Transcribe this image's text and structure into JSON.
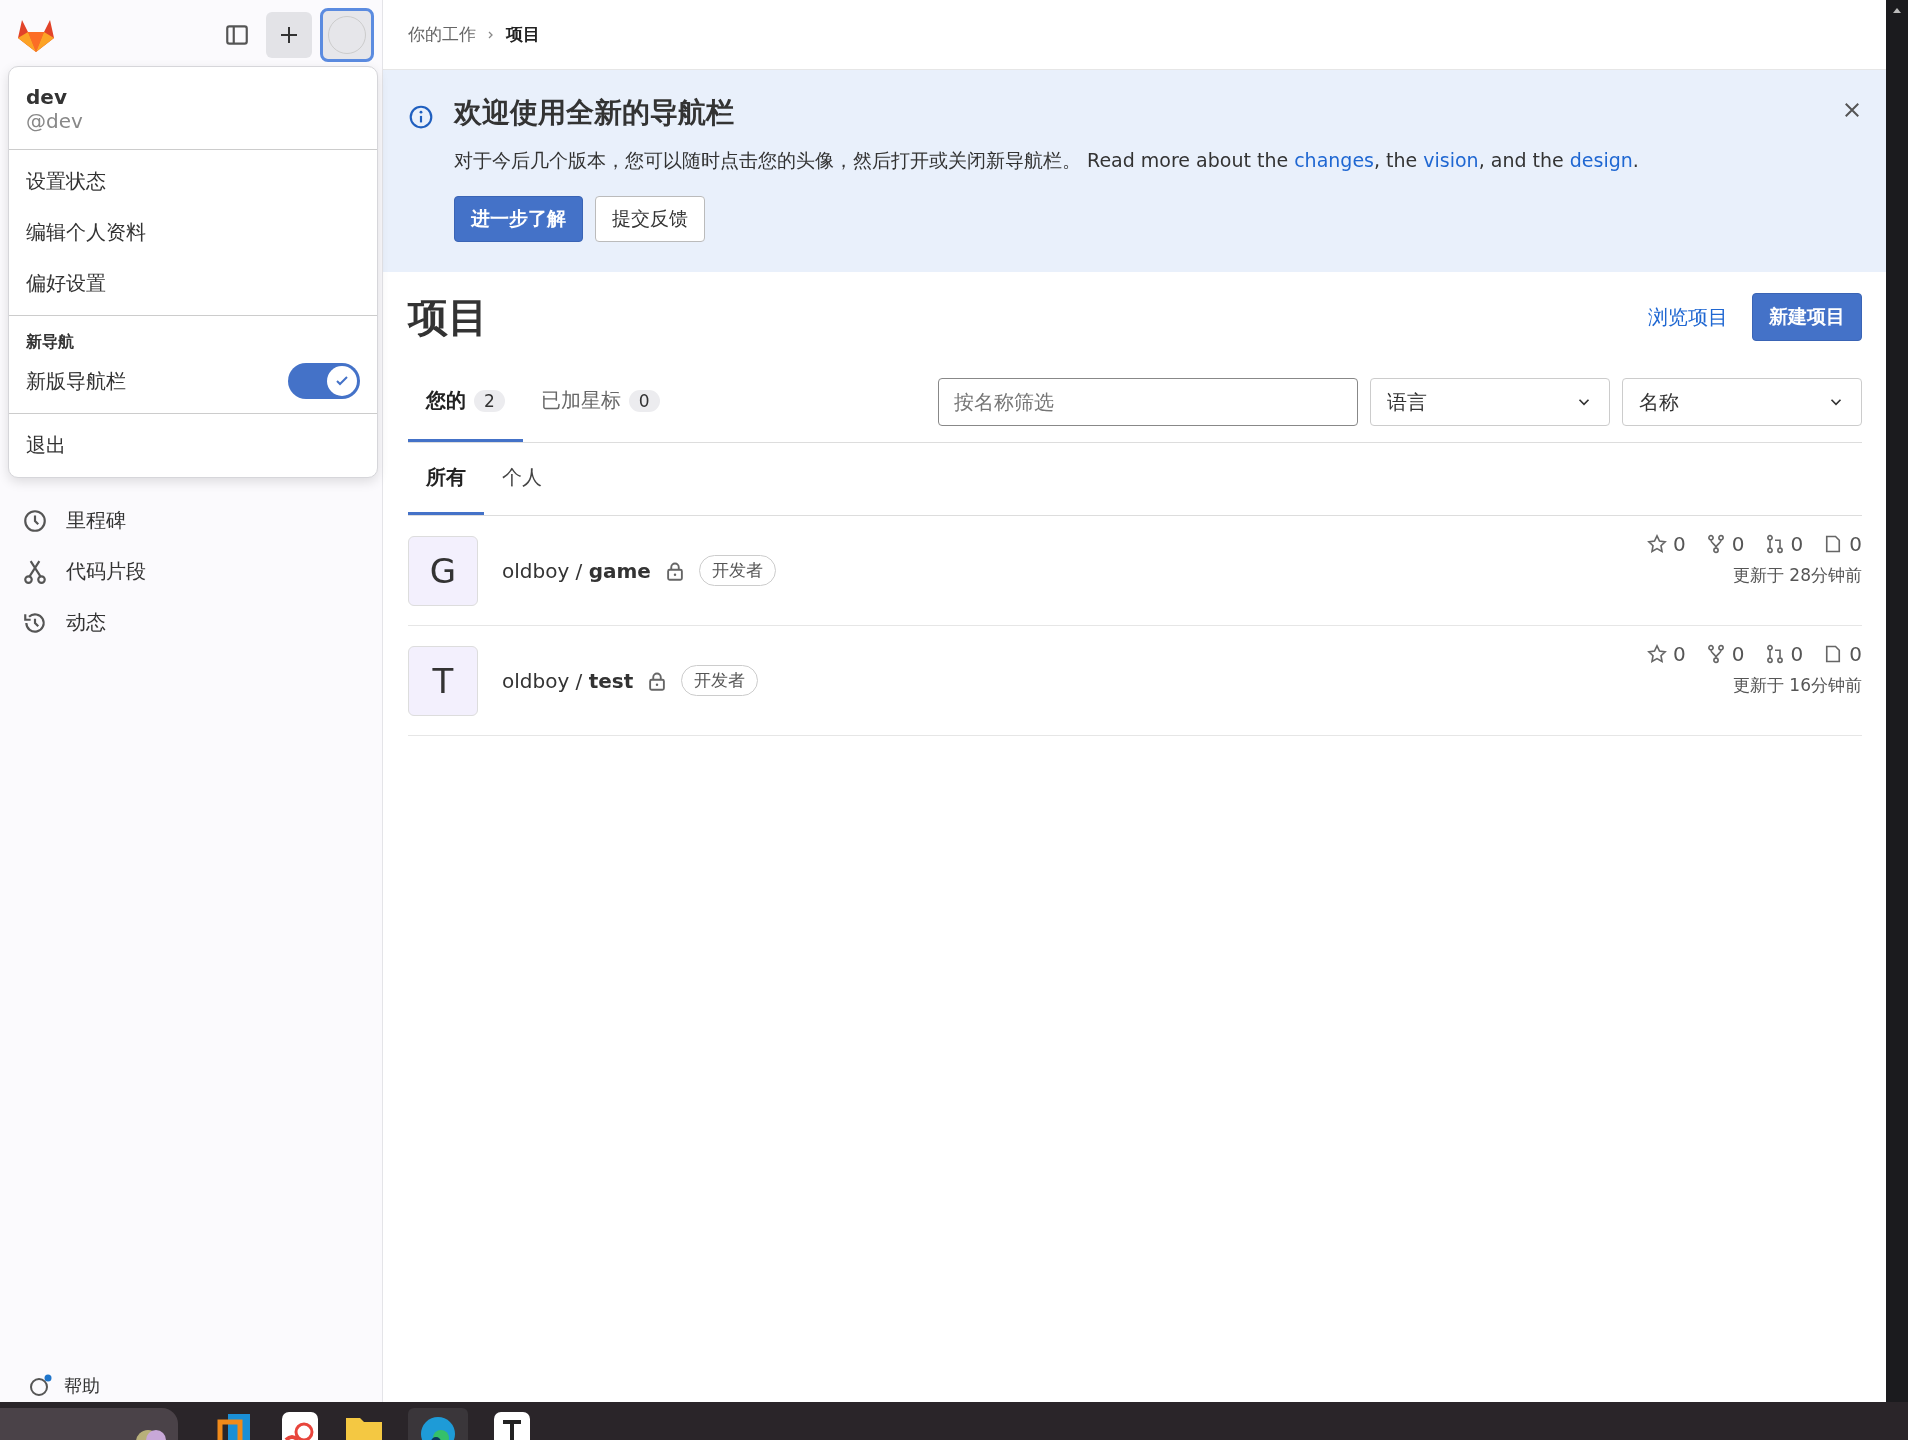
{
  "breadcrumb": [
    {
      "label": "你的工作"
    },
    {
      "label": "项目"
    }
  ],
  "sidebar": {
    "items": [
      {
        "label": "里程碑",
        "kind": "clock"
      },
      {
        "label": "代码片段",
        "kind": "scissors"
      },
      {
        "label": "动态",
        "kind": "history"
      }
    ],
    "help": "帮助"
  },
  "user_menu": {
    "name": "dev",
    "handle": "@dev",
    "items": [
      "设置状态",
      "编辑个人资料",
      "偏好设置"
    ],
    "section_title": "新导航",
    "toggle": {
      "label": "新版导航栏",
      "on": true
    },
    "sign_out": "退出"
  },
  "banner": {
    "title": "欢迎使用全新的导航栏",
    "text": "对于今后几个版本，您可以随时点击您的头像，然后打开或关闭新导航栏。 Read more about the ",
    "links": [
      {
        "text": "changes",
        "after": ", the "
      },
      {
        "text": "vision",
        "after": ", and the "
      },
      {
        "text": "design",
        "after": "."
      }
    ],
    "primary_button": "进一步了解",
    "secondary_button": "提交反馈"
  },
  "page": {
    "title": "项目",
    "browse_link": "浏览项目",
    "new_button": "新建项目"
  },
  "tabs": [
    {
      "label": "您的",
      "count": "2",
      "selected": true
    },
    {
      "label": "已加星标",
      "count": "0",
      "selected": false
    }
  ],
  "filter": {
    "placeholder": "按名称筛选"
  },
  "dropdowns": [
    "语言",
    "名称"
  ],
  "subtabs": [
    {
      "label": "所有",
      "selected": true
    },
    {
      "label": "个人",
      "selected": false
    }
  ],
  "projects": [
    {
      "avatar": "G",
      "namespace": "oldboy / ",
      "name": "game",
      "role": "开发者",
      "stars": "0",
      "forks": "0",
      "merge_requests": "0",
      "issues": "0",
      "updated": "更新于 28分钟前"
    },
    {
      "avatar": "T",
      "namespace": "oldboy / ",
      "name": "test",
      "role": "开发者",
      "stars": "0",
      "forks": "0",
      "merge_requests": "0",
      "issues": "0",
      "updated": "更新于 16分钟前"
    }
  ]
}
